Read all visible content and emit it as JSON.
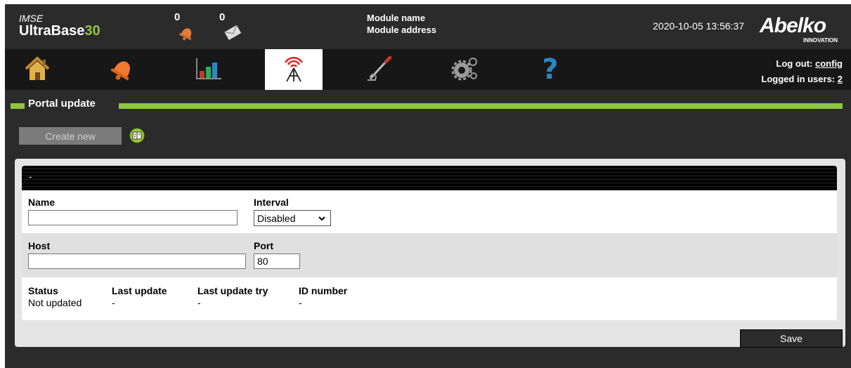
{
  "header": {
    "brand_small": "IMSE",
    "brand_name": "UltraBase",
    "brand_number": "30",
    "alarm_count": "0",
    "message_count": "0",
    "module_name_label": "Module name",
    "module_address_label": "Module address",
    "datetime": "2020-10-05 13:56:37",
    "logo": "Abelko",
    "logo_sub": "INNOVATION"
  },
  "nav": {
    "items": [
      {
        "icon": "home-icon"
      },
      {
        "icon": "alarm-bell-icon"
      },
      {
        "icon": "chart-icon"
      },
      {
        "icon": "antenna-tower-icon",
        "active": true
      },
      {
        "icon": "tools-icon"
      },
      {
        "icon": "settings-gears-icon"
      },
      {
        "icon": "help-icon"
      }
    ],
    "logout_label": "Log out:",
    "logout_user": "config",
    "logged_in_label": "Logged in users:",
    "logged_in_count": "2"
  },
  "section": {
    "title": "Portal update"
  },
  "toolbar": {
    "create_new": "Create new",
    "info_icon": "info-book-icon"
  },
  "form": {
    "header_text": "-",
    "name_label": "Name",
    "name_value": "",
    "interval_label": "Interval",
    "interval_value": "Disabled",
    "host_label": "Host",
    "host_value": "",
    "port_label": "Port",
    "port_value": "80",
    "status": {
      "headers": [
        "Status",
        "Last update",
        "Last update try",
        "ID number"
      ],
      "values": [
        "Not updated",
        "-",
        "-",
        "-"
      ]
    },
    "save_label": "Save"
  },
  "colors": {
    "accent_green": "#8dc63f",
    "dark_bg": "#2b2b2b",
    "nav_bg": "#171717"
  }
}
